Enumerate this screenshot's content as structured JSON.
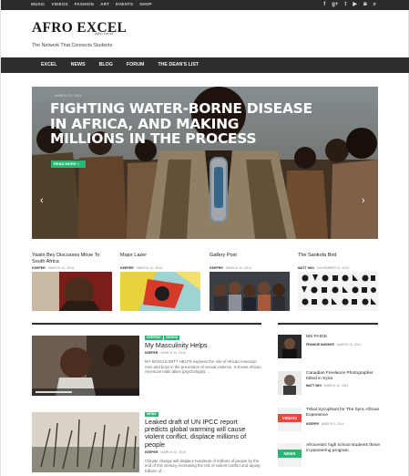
{
  "topbar": {
    "nav": [
      "MUSIC",
      "VIDEOS",
      "FASHION",
      "ART",
      "EVENTS",
      "SHOP"
    ],
    "social_icons": [
      "facebook-icon",
      "google-plus-icon",
      "twitter-icon",
      "youtube-icon",
      "instagram-icon",
      "search-icon"
    ],
    "social_glyphs": [
      "f",
      "g+",
      "t",
      "▶",
      "◙",
      "⌕"
    ]
  },
  "header": {
    "logo": "AFRO EXCEL",
    "logo_script": "Afro excel",
    "tagline": "The Network That Connects Students"
  },
  "mainnav": {
    "items": [
      "EXCEL",
      "NEWS",
      "BLOG",
      "FORUM",
      "THE DEAN'S LIST"
    ]
  },
  "hero": {
    "meta": "— MARCH 22, 2014",
    "title": "FIGHTING WATER-BORNE DISEASE IN AFRICA, AND MAKING MILLIONS IN THE PROCESS",
    "readmore": "READ MORE »",
    "prev": "‹",
    "next": "›"
  },
  "miniposts": [
    {
      "title": "Yasiin Bey Discusses Move To South Africa",
      "author": "KEEPER",
      "date": "MARCH 12, 2014"
    },
    {
      "title": "Major Lazer",
      "author": "KEEPER",
      "date": "MARCH 12, 2014"
    },
    {
      "title": "Gallery Post",
      "author": "KEEPER",
      "date": "MARCH 12, 2014"
    },
    {
      "title": "The Sankofa Bird",
      "author": "MATT WIG",
      "date": "NOVEMBER 11, 2013"
    }
  ],
  "posts": [
    {
      "tags": [
        "KEEPING",
        "VIDEOS"
      ],
      "title": "My Masculinity Helps",
      "author": "KEEPER",
      "date": "MARCH 12, 2014",
      "excerpt": "MY MASCULINITY HELPS explores the role of African American men and boys in the prevention of sexual violence. It shows African American male allies (psychologist, ..."
    },
    {
      "tags": [
        "NEWS"
      ],
      "title": "Leaked draft of UN IPCC report predicts global warming will cause violent conflict, displace millions of people",
      "author": "KEEPER",
      "date": "MARCH 12, 2014",
      "excerpt": "Climate change will displace hundreds of millions of people by the end of this century, increasing the risk of violent conflict and wiping trillions of ..."
    }
  ],
  "sidebar": [
    {
      "title": "MS PAIGE",
      "author": "FRANKIE MARKER",
      "date": "MARCH 12, 2014",
      "cat": ""
    },
    {
      "title": "Canadian Freelance Photographer Killed in Syria",
      "author": "MATT WIG",
      "date": "MARCH 12, 2014",
      "cat": ""
    },
    {
      "title": "Tribal Sycophant for The Sync African Experience",
      "author": "KEEPER",
      "date": "MARCH 3, 2014",
      "cat": "VIDEOS"
    },
    {
      "title": "Afrocentric high school students thrive in pioneering program",
      "author": "KEEPER",
      "date": "MARCH 12, 2014",
      "cat": "NEWS"
    }
  ],
  "colors": {
    "accent": "#2bb673",
    "videos": "#e14b3b",
    "nav_bg": "#2e2e2e"
  }
}
